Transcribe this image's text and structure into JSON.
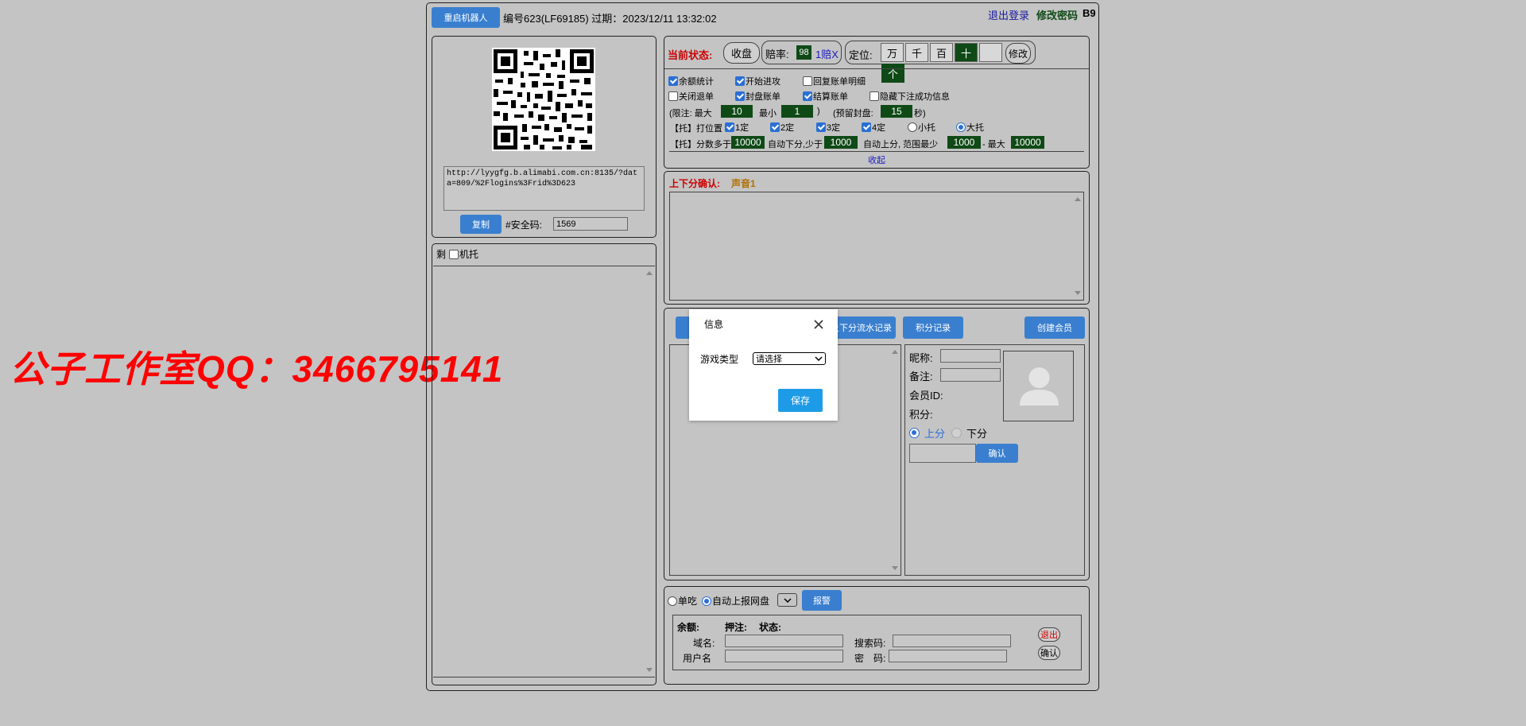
{
  "watermark": "公子工作室QQ：3466795141",
  "header": {
    "restart_label": "重启机器人",
    "account_info": "编号623(LF69185) 过期：2023/12/11 13:32:02",
    "logout_label": "退出登录",
    "change_password_label": "修改密码",
    "b9_label": "B9"
  },
  "left_panel": {
    "url": "http://lyygfg.b.alimabi.com.cn:8135/?data=809/%2Flogins%3Frid%3D623",
    "copy_label": "复制",
    "security_code_label": "#安全码:",
    "security_code_value": "1569",
    "lower_header_prefix": "剩",
    "robot_support_label": "机托"
  },
  "status_bar": {
    "current_status_label": "当前状态:",
    "close_label": "收盘",
    "odds_label": "赔率:",
    "odds_value": "98",
    "odds_suffix": "1赔X",
    "position_label": "定位:",
    "positions": [
      "万",
      "千",
      "百",
      "十",
      "个"
    ],
    "modify_label": "修改"
  },
  "options": {
    "row1": [
      {
        "label": "余额统计",
        "checked": true
      },
      {
        "label": "开始进攻",
        "checked": true
      },
      {
        "label": "回复账单明细",
        "checked": false
      }
    ],
    "row2": [
      {
        "label": "关闭退单",
        "checked": false
      },
      {
        "label": "封盘账单",
        "checked": true
      },
      {
        "label": "结算账单",
        "checked": true
      },
      {
        "label": "隐藏下注成功信息",
        "checked": false
      }
    ],
    "limit_prefix": "(限注: 最大",
    "limit_max": "10",
    "limit_min_label": "最小",
    "limit_min": "1",
    "limit_close_paren": ")",
    "reserve_label": "(预留封盘:",
    "reserve_value": "15",
    "reserve_unit": "秒)",
    "support_pos_label": "【托】打位置",
    "support_positions": [
      {
        "label": "1定",
        "checked": true
      },
      {
        "label": "2定",
        "checked": true
      },
      {
        "label": "3定",
        "checked": true
      },
      {
        "label": "4定",
        "checked": true
      }
    ],
    "small_support_label": "小托",
    "big_support_label": "大托",
    "score_label": "【托】分数多于",
    "score_value": "10000",
    "auto_down_label": "自动下分,少于",
    "auto_down_value": "1000",
    "auto_up_label": "自动上分, 范围最少",
    "range_min": "1000",
    "range_sep": "- 最大",
    "range_max": "10000",
    "collapse_label": "收起"
  },
  "confirm_section": {
    "label": "上下分确认:",
    "sound_label": "声音1"
  },
  "member_tabs": {
    "flow_label": "上下分流水记录",
    "points_label": "积分记录",
    "create_label": "创建会员"
  },
  "member_detail": {
    "nickname_label": "昵称:",
    "remark_label": "备注:",
    "member_id_label": "会员ID:",
    "points_label": "积分:",
    "up_label": "上分",
    "down_label": "下分",
    "confirm_label": "确认"
  },
  "bottom_panel": {
    "single_label": "单吃",
    "auto_report_label": "自动上报网盘",
    "report_label": "报警",
    "balance_label": "余额:",
    "bet_label": "押注:",
    "state_label": "状态:",
    "domain_label": "域名:",
    "search_code_label": "搜索码:",
    "username_label": "用户名",
    "password_label": "密　码:",
    "exit_label": "退出",
    "ok_label": "确认"
  },
  "modal": {
    "title": "信息",
    "game_type_label": "游戏类型",
    "select_value": "请选择",
    "save_label": "保存"
  },
  "colors": {
    "accent_blue": "#3a7fcf",
    "dark_green": "#0f4a16",
    "status_red": "#cc0000",
    "watermark_red": "#ff0000"
  }
}
